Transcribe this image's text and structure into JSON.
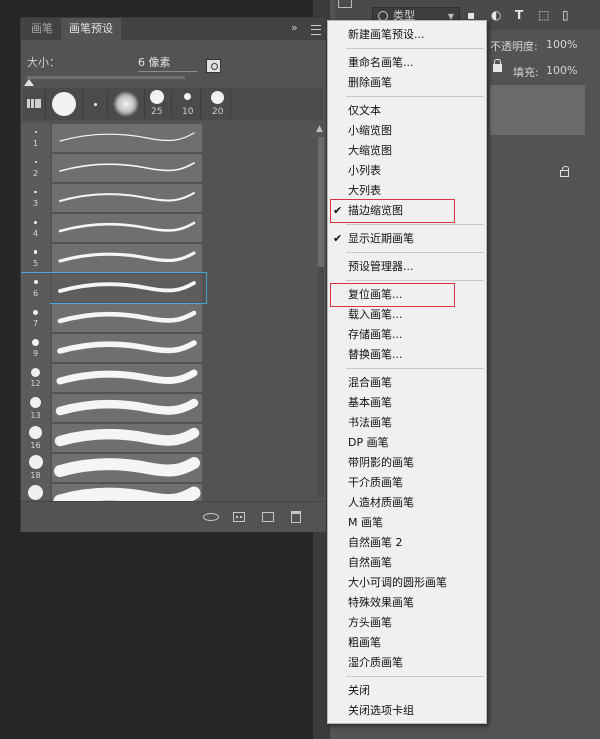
{
  "panel": {
    "tabs": [
      "画笔",
      "画笔预设"
    ],
    "collapse_icon": "»",
    "size_label": "大小：",
    "size_value": "6 像素",
    "tip_sizes": [
      "",
      "",
      "25",
      "10",
      "20"
    ]
  },
  "brush_list": {
    "items": [
      {
        "num": "1"
      },
      {
        "num": "2"
      },
      {
        "num": "3"
      },
      {
        "num": "4"
      },
      {
        "num": "5"
      },
      {
        "num": "6"
      },
      {
        "num": "7"
      },
      {
        "num": "9"
      },
      {
        "num": "12"
      },
      {
        "num": "13"
      },
      {
        "num": "16"
      },
      {
        "num": "18"
      },
      {
        "num": ""
      }
    ],
    "selected_index": 5
  },
  "layers": {
    "kind_label": "类型",
    "opacity_label": "不透明度:",
    "opacity_value": "100%",
    "fill_label": "填充:",
    "fill_value": "100%"
  },
  "menu": {
    "groups": [
      {
        "items": [
          {
            "label": "新建画笔预设..."
          }
        ]
      },
      {
        "items": [
          {
            "label": "重命名画笔..."
          },
          {
            "label": "删除画笔"
          }
        ]
      },
      {
        "items": [
          {
            "label": "仅文本"
          },
          {
            "label": "小缩览图"
          },
          {
            "label": "大缩览图"
          },
          {
            "label": "小列表"
          },
          {
            "label": "大列表"
          },
          {
            "label": "描边缩览图",
            "checked": true,
            "highlighted": true
          }
        ]
      },
      {
        "items": [
          {
            "label": "显示近期画笔",
            "checked": true
          }
        ]
      },
      {
        "items": [
          {
            "label": "预设管理器..."
          }
        ]
      },
      {
        "items": [
          {
            "label": "复位画笔...",
            "highlighted": true
          },
          {
            "label": "载入画笔..."
          },
          {
            "label": "存储画笔..."
          },
          {
            "label": "替换画笔..."
          }
        ]
      },
      {
        "items": [
          {
            "label": "混合画笔"
          },
          {
            "label": "基本画笔"
          },
          {
            "label": "书法画笔"
          },
          {
            "label": "DP 画笔"
          },
          {
            "label": "带阴影的画笔"
          },
          {
            "label": "干介质画笔"
          },
          {
            "label": "人造材质画笔"
          },
          {
            "label": "M 画笔"
          },
          {
            "label": "自然画笔 2"
          },
          {
            "label": "自然画笔"
          },
          {
            "label": "大小可调的圆形画笔"
          },
          {
            "label": "特殊效果画笔"
          },
          {
            "label": "方头画笔"
          },
          {
            "label": "粗画笔"
          },
          {
            "label": "湿介质画笔"
          }
        ]
      },
      {
        "items": [
          {
            "label": "关闭"
          },
          {
            "label": "关闭选项卡组"
          }
        ]
      }
    ],
    "highlight_color": "#d8333a",
    "check_glyph": "✔"
  },
  "colors": {
    "selection_outline": "#4aa8d8",
    "panel_bg": "#535353"
  }
}
